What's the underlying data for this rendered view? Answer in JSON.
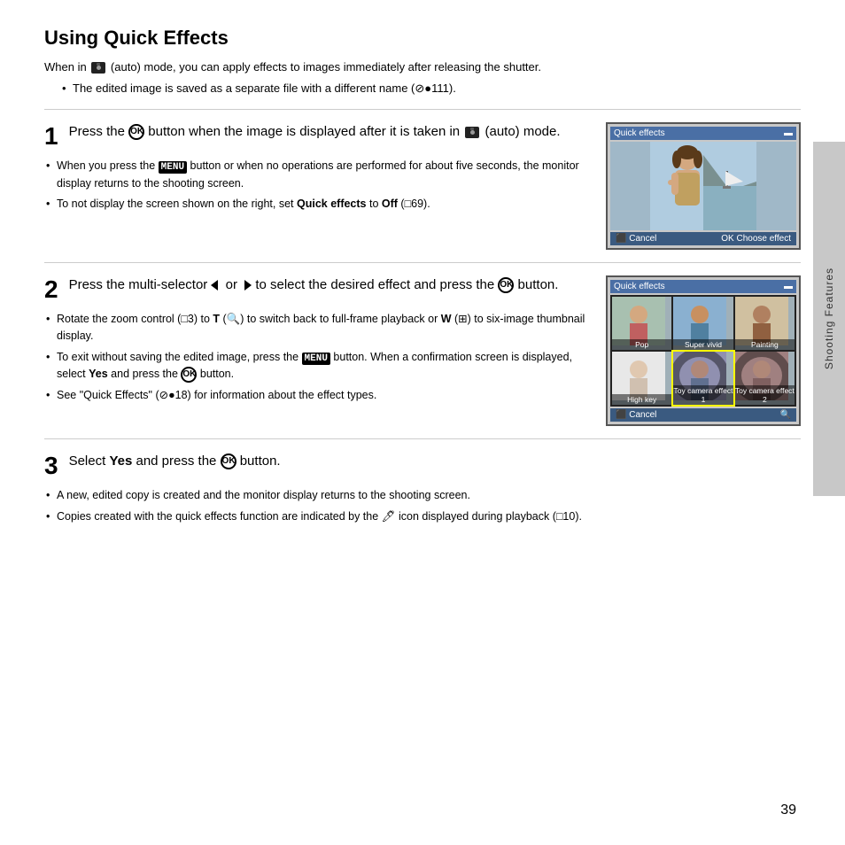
{
  "page": {
    "title": "Using Quick Effects",
    "page_number": "39",
    "sidebar_label": "Shooting Features"
  },
  "intro": {
    "line1": "When in  (auto) mode, you can apply effects to images immediately after releasing the shutter.",
    "bullet1": "The edited image is saved as a separate file with a different name (⊘●111)."
  },
  "step1": {
    "number": "1",
    "title_part1": "Press the ",
    "title_ok": "OK",
    "title_part2": " button when the image is displayed after it is taken in ",
    "title_camera": "",
    "title_part3": " (auto) mode.",
    "bullet1": "When you press the MENU button or when no operations are performed for about five seconds, the monitor display returns to the shooting screen.",
    "bullet2": "To not display the screen shown on the right, set Quick effects to Off (□69).",
    "lcd1_header": "Quick effects",
    "lcd1_cancel": "⬛ Cancel",
    "lcd1_choose": "OK Choose effect"
  },
  "step2": {
    "number": "2",
    "title_part1": "Press the multi-selector ",
    "title_or": "or",
    "title_part2": " to select the desired effect and press the ",
    "title_ok": "OK",
    "title_part3": " button.",
    "bullet1": "Rotate the zoom control (□3) to T (🔍) to switch back to full-frame playback or W (⊞) to six-image thumbnail display.",
    "bullet2": "To exit without saving the edited image, press the MENU button. When a confirmation screen is displayed, select Yes and press the OK button.",
    "bullet3": "See \"Quick Effects\" (⊘●18) for information about the effect types.",
    "lcd2_header": "Quick effects",
    "lcd2_effects": [
      "Pop",
      "Super vivid",
      "Painting",
      "High key",
      "Toy camera\neffect 1",
      "Toy camera\neffect 2"
    ],
    "lcd2_cancel": "⬛ Cancel"
  },
  "step3": {
    "number": "3",
    "title_part1": "Select ",
    "title_yes": "Yes",
    "title_part2": " and press the ",
    "title_ok": "OK",
    "title_part3": " button.",
    "bullet1": "A new, edited copy is created and the monitor display returns to the shooting screen.",
    "bullet2": "Copies created with the quick effects function are indicated by the 🖊 icon displayed during playback (□10)."
  },
  "icons": {
    "ok_symbol": "OK",
    "camera_symbol": "📷",
    "arrow_left": "◀",
    "arrow_right": "▶"
  }
}
